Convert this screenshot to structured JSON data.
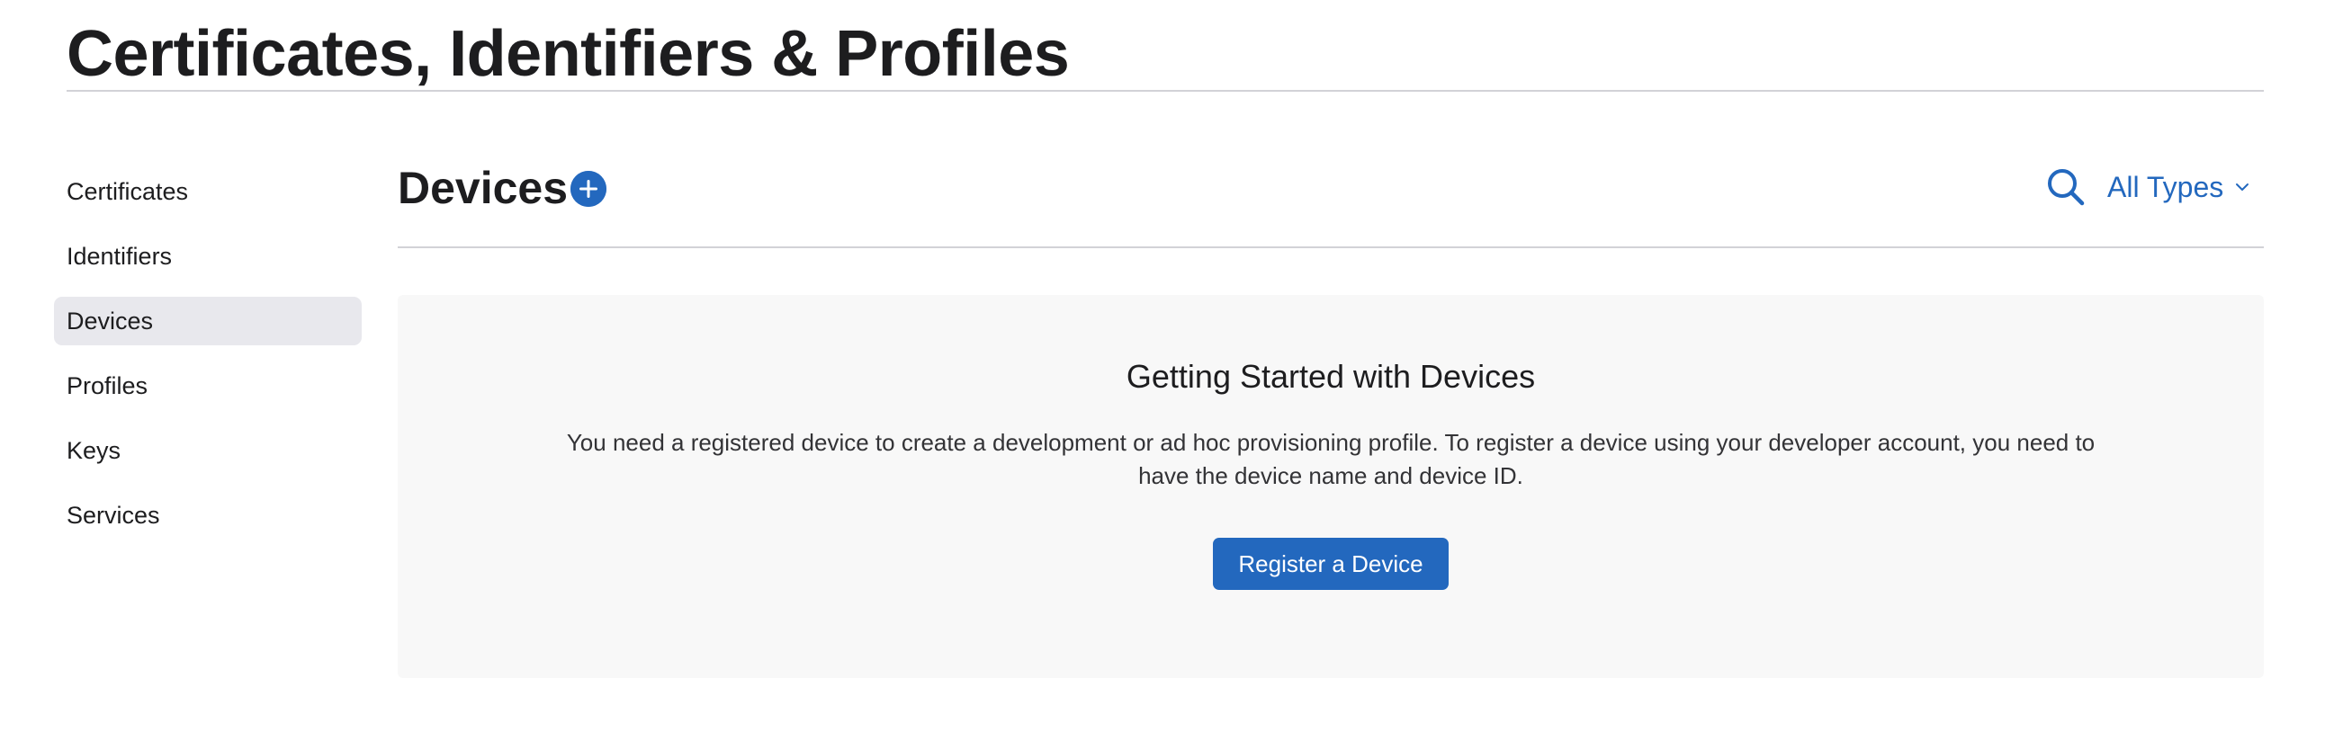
{
  "header": {
    "title": "Certificates, Identifiers & Profiles"
  },
  "sidebar": {
    "items": [
      {
        "label": "Certificates",
        "active": false
      },
      {
        "label": "Identifiers",
        "active": false
      },
      {
        "label": "Devices",
        "active": true
      },
      {
        "label": "Profiles",
        "active": false
      },
      {
        "label": "Keys",
        "active": false
      },
      {
        "label": "Services",
        "active": false
      }
    ]
  },
  "main": {
    "title": "Devices",
    "add_icon": "plus-circle-icon",
    "search_icon": "search-icon",
    "filter": {
      "label": "All Types",
      "icon": "chevron-down-icon"
    },
    "empty_state": {
      "title": "Getting Started with Devices",
      "text": "You need a registered device to create a development or ad hoc provisioning profile. To register a device using your developer account, you need to have the device name and device ID.",
      "button_label": "Register a Device"
    }
  },
  "colors": {
    "accent": "#2368be",
    "active_item_bg": "#e8e8ed",
    "panel_bg": "#f8f8f8",
    "divider": "#d2d2d7",
    "text": "#1d1d1f"
  }
}
